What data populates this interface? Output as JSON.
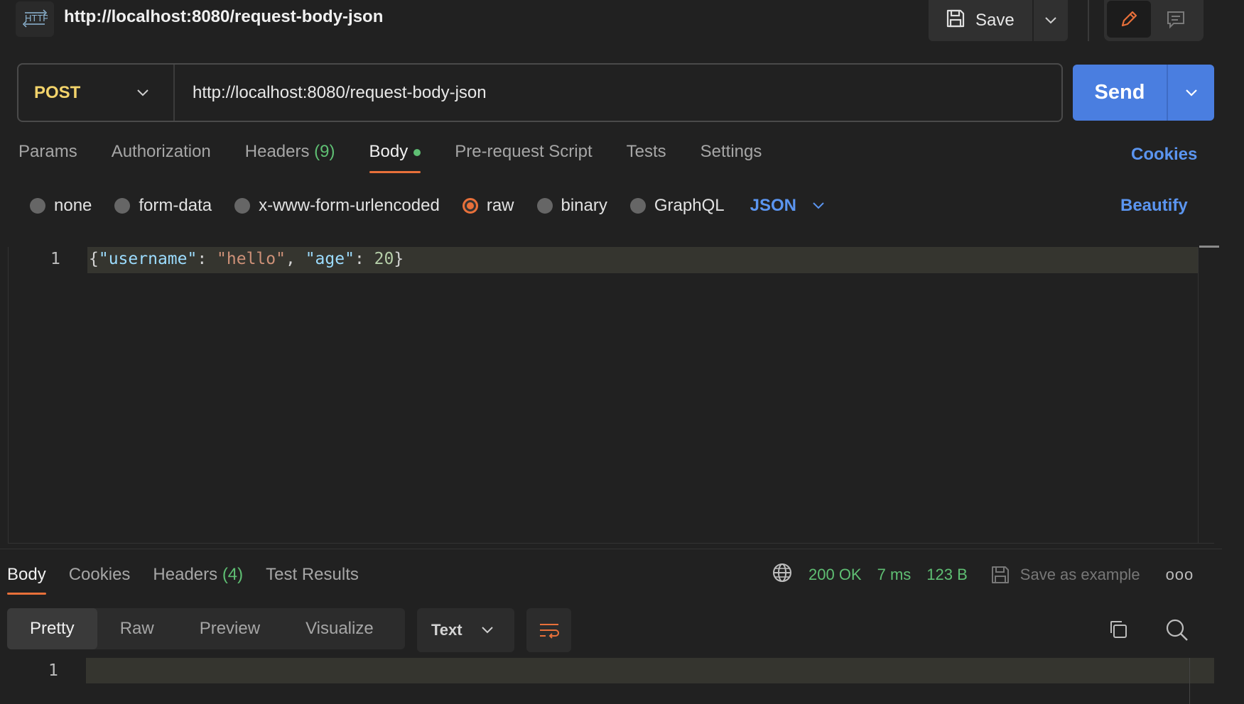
{
  "request": {
    "title": "http://localhost:8080/request-body-json",
    "method": "POST",
    "url": "http://localhost:8080/request-body-json",
    "save_label": "Save",
    "send_label": "Send"
  },
  "request_tabs": [
    {
      "label": "Params"
    },
    {
      "label": "Authorization"
    },
    {
      "label": "Headers",
      "count": "(9)"
    },
    {
      "label": "Body"
    },
    {
      "label": "Pre-request Script"
    },
    {
      "label": "Tests"
    },
    {
      "label": "Settings"
    }
  ],
  "cookies_label": "Cookies",
  "body_types": [
    {
      "label": "none"
    },
    {
      "label": "form-data"
    },
    {
      "label": "x-www-form-urlencoded"
    },
    {
      "label": "raw"
    },
    {
      "label": "binary"
    },
    {
      "label": "GraphQL"
    }
  ],
  "raw_format": "JSON",
  "beautify_label": "Beautify",
  "editor": {
    "line_number": "1",
    "code": "{\"username\": \"hello\", \"age\": 20}",
    "tokens": {
      "open": "{",
      "key1": "\"username\"",
      "colon1": ": ",
      "val1": "\"hello\"",
      "comma": ", ",
      "key2": "\"age\"",
      "colon2": ": ",
      "val2": "20",
      "close": "}"
    }
  },
  "response": {
    "tabs": [
      {
        "label": "Body"
      },
      {
        "label": "Cookies"
      },
      {
        "label": "Headers",
        "count": "(4)"
      },
      {
        "label": "Test Results"
      }
    ],
    "status": "200 OK",
    "time": "7 ms",
    "size": "123 B",
    "save_example_label": "Save as example",
    "more_label": "ooo",
    "views": [
      "Pretty",
      "Raw",
      "Preview",
      "Visualize"
    ],
    "text_format": "Text",
    "line_number": "1"
  },
  "colors": {
    "accent": "#e8703a",
    "link": "#5b95f0",
    "send": "#4a7ee0",
    "success": "#5fbf73",
    "method": "#f2d36b"
  },
  "icons": {
    "http": "http-icon",
    "save": "floppy-disk-icon",
    "edit": "pencil-icon",
    "comment": "comment-icon",
    "globe": "globe-icon",
    "copy": "copy-icon",
    "search": "search-icon",
    "wrap": "wrap-lines-icon"
  }
}
